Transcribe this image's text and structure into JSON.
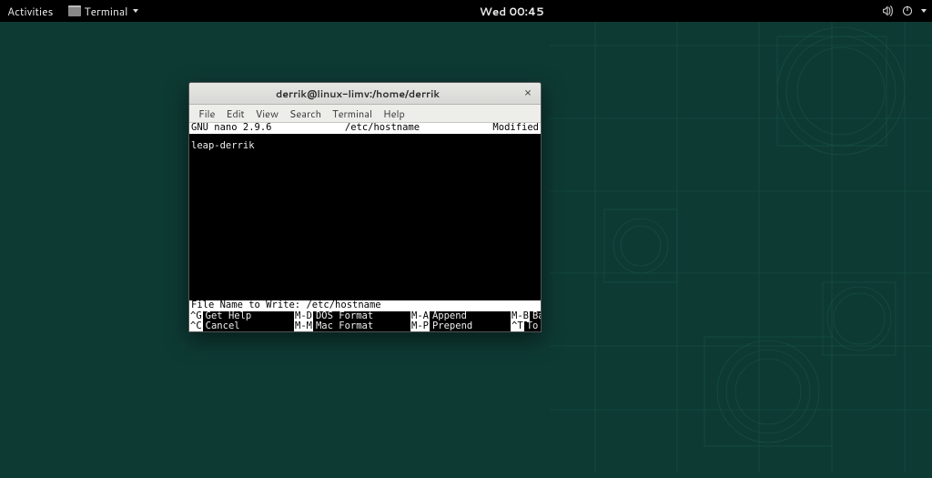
{
  "topbar": {
    "activities": "Activities",
    "app_name": "Terminal",
    "clock": "Wed 00:45"
  },
  "window": {
    "title": "derrik@linux-limv:/home/derrik",
    "menus": [
      "File",
      "Edit",
      "View",
      "Search",
      "Terminal",
      "Help"
    ]
  },
  "nano": {
    "header_left": "  GNU nano 2.9.6",
    "header_center": "/etc/hostname",
    "header_right": "Modified ",
    "body": "leap-derrik",
    "prompt_label": "File Name to Write: ",
    "prompt_value": "/etc/hostname",
    "shortcuts": [
      {
        "key": "^G",
        "label": "Get Help"
      },
      {
        "key": "M-D",
        "label": "DOS Format"
      },
      {
        "key": "M-A",
        "label": "Append"
      },
      {
        "key": "M-B",
        "label": "Backup File"
      },
      {
        "key": "^C",
        "label": "Cancel"
      },
      {
        "key": "M-M",
        "label": "Mac Format"
      },
      {
        "key": "M-P",
        "label": "Prepend"
      },
      {
        "key": "^T",
        "label": "To Files"
      }
    ]
  }
}
